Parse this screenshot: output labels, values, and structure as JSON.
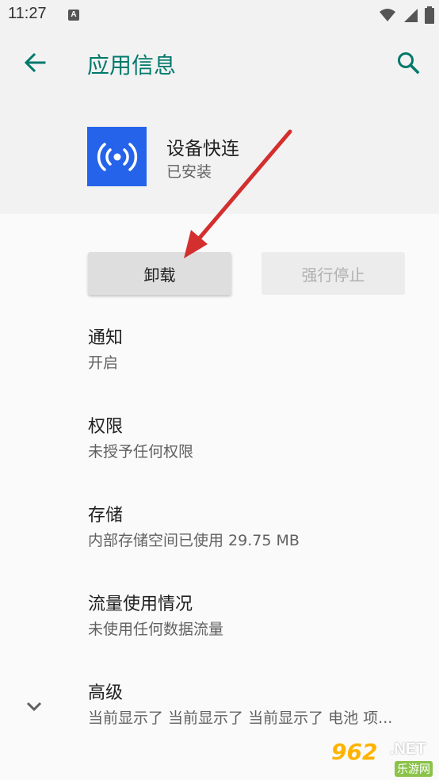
{
  "status_bar": {
    "time": "11:27",
    "notification_badge": "A"
  },
  "header": {
    "title": "应用信息"
  },
  "app": {
    "name": "设备快连",
    "status": "已安装"
  },
  "buttons": {
    "uninstall": "卸载",
    "force_stop": "强行停止"
  },
  "items": [
    {
      "title": "通知",
      "subtitle": "开启"
    },
    {
      "title": "权限",
      "subtitle": "未授予任何权限"
    },
    {
      "title": "存储",
      "subtitle": "内部存储空间已使用 29.75 MB"
    },
    {
      "title": "流量使用情况",
      "subtitle": "未使用任何数据流量"
    },
    {
      "title": "高级",
      "subtitle": "当前显示了 当前显示了 当前显示了 电池 项..."
    }
  ],
  "watermark": {
    "main": "962",
    "net": ".NET",
    "sub": "乐游网"
  },
  "colors": {
    "accent": "#00796b",
    "app_icon_bg": "#2563eb",
    "annotation_arrow": "#d32f2f"
  },
  "icons": [
    "back-arrow-icon",
    "search-icon",
    "wifi-icon",
    "signal-icon",
    "battery-icon",
    "broadcast-icon",
    "chevron-down-icon"
  ]
}
